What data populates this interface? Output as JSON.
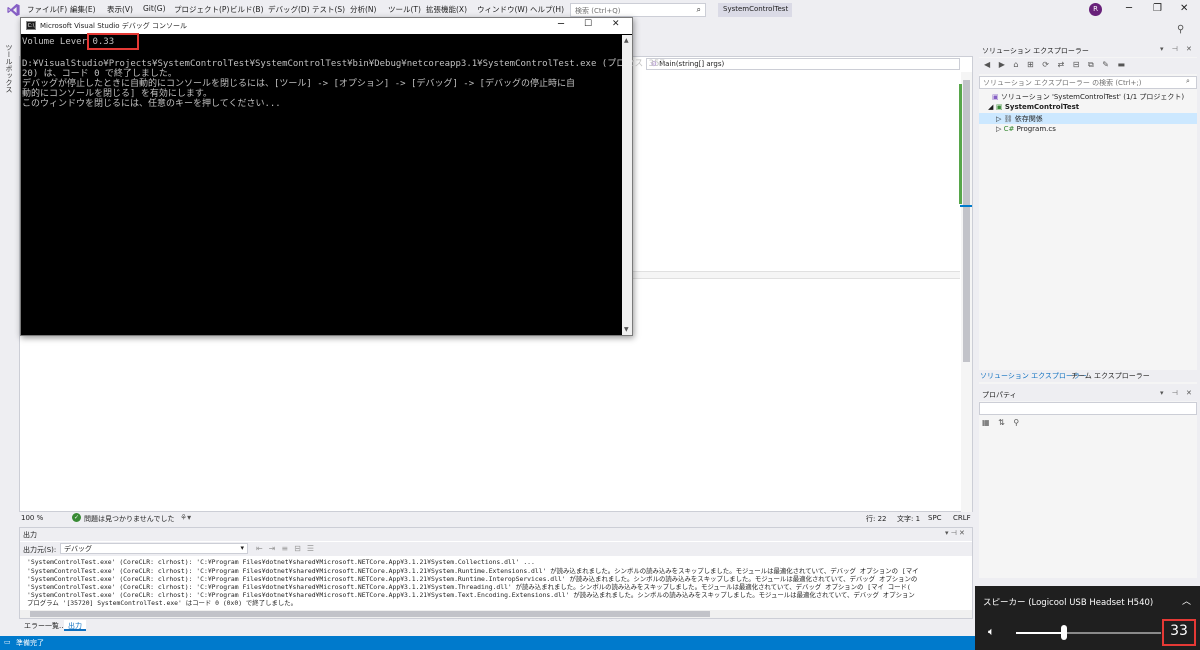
{
  "menubar": {
    "items": [
      "ファイル(F)",
      "編集(E)",
      "表示(V)",
      "Git(G)",
      "プロジェクト(P)",
      "ビルド(B)",
      "デバッグ(D)",
      "テスト(S)",
      "分析(N)",
      "ツール(T)",
      "拡張機能(X)",
      "ウィンドウ(W)",
      "ヘルプ(H)"
    ],
    "search_placeholder": "検索 (Ctrl+Q)",
    "search_icon": "⌕",
    "project_name": "SystemControlTest",
    "user_initial": "R"
  },
  "toolbox": {
    "label": "ツールボックス"
  },
  "editor": {
    "nav_method": "Main(string[] args)",
    "zoom": "100 %",
    "issues": "問題は見つかりませんでした",
    "line": "行: 22",
    "col": "文字: 1",
    "spc": "SPC",
    "crlf": "CRLF"
  },
  "output": {
    "title": "出力",
    "source_label": "出力元(S):",
    "source_value": "デバッグ",
    "lines": [
      "'SystemControlTest.exe' (CoreCLR: clrhost): 'C:¥Program Files¥dotnet¥shared¥Microsoft.NETCore.App¥3.1.21¥System.Runtime.Extensions.dll' が読み込まれました。シンボルの読み込みをスキップしました。モジュールは最適化されていて、デバッグ オプションの [マイ",
      "'SystemControlTest.exe' (CoreCLR: clrhost): 'C:¥Program Files¥dotnet¥shared¥Microsoft.NETCore.App¥3.1.21¥System.Runtime.InteropServices.dll' が読み込まれました。シンボルの読み込みをスキップしました。モジュールは最適化されていて、デバッグ オプションの",
      "'SystemControlTest.exe' (CoreCLR: clrhost): 'C:¥Program Files¥dotnet¥shared¥Microsoft.NETCore.App¥3.1.21¥System.Threading.dll' が読み込まれました。シンボルの読み込みをスキップしました。モジュールは最適化されていて、デバッグ オプションの [マイ コード(",
      "'SystemControlTest.exe' (CoreCLR: clrhost): 'C:¥Program Files¥dotnet¥shared¥Microsoft.NETCore.App¥3.1.21¥System.Text.Encoding.Extensions.dll' が読み込まれました。シンボルの読み込みをスキップしました。モジュールは最適化されていて、デバッグ オプション",
      "プログラム '[35720] SystemControlTest.exe' はコード 0 (0x0) で終了しました。"
    ]
  },
  "bottom_tabs": [
    "エラー一覧...",
    "出力"
  ],
  "statusbar": {
    "ready": "準備完了"
  },
  "solution_explorer": {
    "title": "ソリューション エクスプローラー",
    "search_placeholder": "ソリューション エクスプローラー の検索 (Ctrl+;)",
    "tree": {
      "solution": "ソリューション 'SystemControlTest' (1/1 プロジェクト)",
      "project": "SystemControlTest",
      "dependencies": "依存関係",
      "program": "Program.cs"
    },
    "tabs": [
      "ソリューション エクスプローラー",
      "チーム エクスプローラー"
    ]
  },
  "properties": {
    "title": "プロパティ"
  },
  "console": {
    "title": "Microsoft Visual Studio デバッグ コンソール",
    "lines": [
      "Volume Lever  0.33",
      "",
      "D:¥VisualStudio¥Projects¥SystemControlTest¥SystemControlTest¥bin¥Debug¥netcoreapp3.1¥SystemControlTest.exe (プロセス 357",
      "20) は、コード 0 で終了しました。",
      "デバッグが停止したときに自動的にコンソールを閉じるには、[ツール] -> [オプション] -> [デバッグ] -> [デバッグの停止時に自",
      "動的にコンソールを閉じる] を有効にします。",
      "このウィンドウを閉じるには、任意のキーを押してください..."
    ]
  },
  "volume_flyout": {
    "device": "スピーカー (Logicool USB Headset H540)",
    "level": 33,
    "level_text": "33"
  },
  "colors": {
    "accent_blue": "#007acc",
    "highlight_red": "#e53935",
    "console_bg": "#000000",
    "flyout_bg": "#1f1f1f"
  }
}
